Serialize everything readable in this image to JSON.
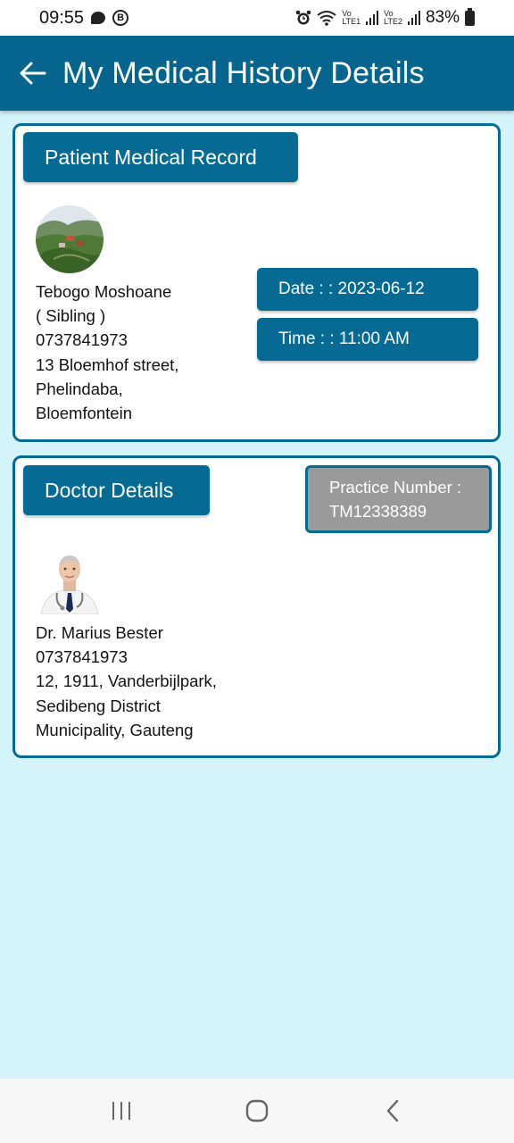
{
  "status_bar": {
    "time": "09:55",
    "battery": "83%",
    "sim1_label": "LTE1",
    "sim2_label": "LTE2",
    "vo_label": "Vo",
    "b_badge": "B",
    "icons": [
      "chat-bubble-icon",
      "b-badge-icon",
      "alarm-icon",
      "wifi-icon",
      "signal-icon",
      "battery-icon"
    ]
  },
  "app_bar": {
    "title": "My Medical History Details",
    "back_icon": "arrow-left-icon",
    "color": "#05658f"
  },
  "patient_card": {
    "heading": "Patient Medical Record",
    "avatar_icon": "landscape-photo",
    "name": "Tebogo Moshoane",
    "relation": "( Sibling )",
    "phone": "0737841973",
    "address_line1": "13 Bloemhof street,",
    "address_line2": "Phelindaba,",
    "address_line3": "Bloemfontein",
    "date": "Date : : 2023-06-12",
    "time": "Time : : 11:00 AM"
  },
  "doctor_card": {
    "heading": "Doctor Details",
    "practice_label": "Practice Number :",
    "practice_number": "TM12338389",
    "avatar_icon": "doctor-photo",
    "name": "Dr. Marius Bester",
    "phone": "0737841973",
    "address_line1": "12, 1911, Vanderbijlpark,",
    "address_line2": "Sedibeng District",
    "address_line3": "Municipality, Gauteng"
  },
  "nav_bar": {
    "icons": [
      "recent-apps-icon",
      "home-icon",
      "back-icon"
    ]
  },
  "colors": {
    "accent": "#056a94",
    "background": "#d4f3fb",
    "practice_box": "#9a9a9a"
  }
}
